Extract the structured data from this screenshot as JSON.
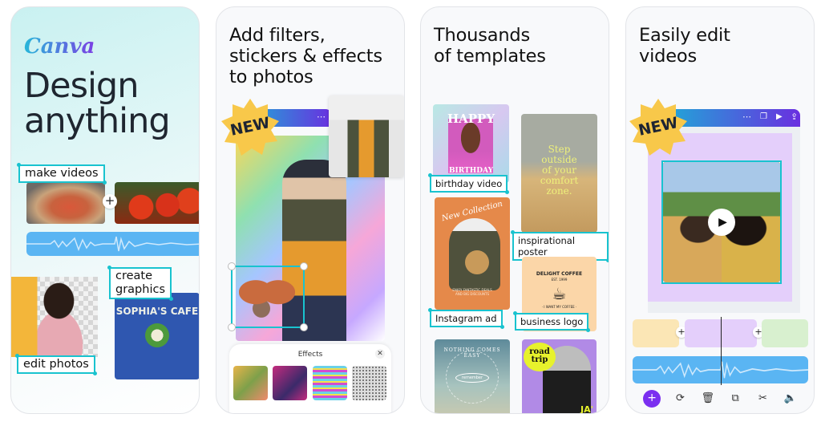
{
  "panels": [
    {
      "logo": "Canva",
      "headline": "Design\nanything",
      "tags": [
        "make videos",
        "create\ngraphics",
        "edit photos"
      ],
      "cafe_sign": "SOPHIA'S CAFE",
      "colors": {
        "accent": "#19c3cf",
        "wave": "#5ab5f3",
        "cafe": "#2f57b0"
      }
    },
    {
      "headline": "Add filters,\nstickers & effects\nto photos",
      "badge": "NEW",
      "more_icon": "⋯",
      "effects_title": "Effects",
      "close_icon": "✕",
      "effects_count": 4
    },
    {
      "headline": "Thousands\nof templates",
      "tags": [
        "birthday video",
        "inspirational poster",
        "Instagram ad",
        "business logo"
      ],
      "templates": {
        "birthday_top": "HAPPY",
        "birthday_bottom": "BIRTHDAY",
        "poster_text": "Step\noutside\nof your\ncomfort\nzone.",
        "ad_title": "New Collection",
        "ad_sub": "ENJOY FANTASTIC DEALS\nAND BIG DISCOUNTS",
        "logo_title": "DELIGHT COFFEE",
        "logo_est": "EST. 1999",
        "logo_sub": "· I WANT MY COFFEE ·",
        "circle_text": "NOTHING COMES EASY",
        "circle_center": "remember",
        "road_trip": "road\ntrip",
        "road_small": "JA'"
      }
    },
    {
      "headline": "Easily edit\nvideos",
      "badge": "NEW",
      "toolbar_icons": [
        "more-icon",
        "layers-icon",
        "play-icon",
        "share-icon"
      ],
      "toolbar_glyphs": [
        "⋯",
        "❐",
        "▶",
        "⇪"
      ],
      "play_glyph": "▶",
      "bottom_tools": [
        {
          "name": "add-icon",
          "glyph": "+"
        },
        {
          "name": "replace-icon",
          "glyph": "⟳"
        },
        {
          "name": "delete-icon",
          "glyph": "🗑"
        },
        {
          "name": "duplicate-icon",
          "glyph": "⧉"
        },
        {
          "name": "cut-icon",
          "glyph": "✂"
        },
        {
          "name": "volume-icon",
          "glyph": "🔈"
        }
      ],
      "colors": {
        "toolbar_start": "#16b8d6",
        "toolbar_end": "#6a2fe0",
        "add": "#7b2ff0",
        "frame": "#e4cffb"
      }
    }
  ]
}
